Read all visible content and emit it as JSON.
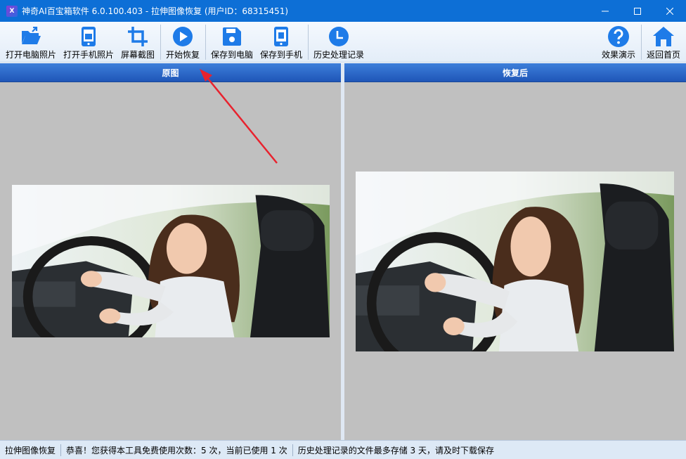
{
  "window": {
    "title": "神奇AI百宝箱软件 6.0.100.403 - 拉伸图像恢复 (用户ID：68315451)",
    "app_icon": "X"
  },
  "toolbar": {
    "open_pc_photo": "打开电脑照片",
    "open_phone_photo": "打开手机照片",
    "screenshot": "屏幕截图",
    "start_restore": "开始恢复",
    "save_to_pc": "保存到电脑",
    "save_to_phone": "保存到手机",
    "history": "历史处理记录",
    "demo": "效果演示",
    "home": "返回首页"
  },
  "panels": {
    "original": "原图",
    "restored": "恢复后"
  },
  "statusbar": {
    "mode": "拉伸图像恢复",
    "usage": "恭喜！您获得本工具免费使用次数：5 次，当前已使用 1 次",
    "storage": "历史处理记录的文件最多存储 3 天，请及时下载保存"
  },
  "colors": {
    "titlebar": "#0d6fd6",
    "accent": "#1e7be8",
    "panel_header": "#2a63c4",
    "canvas": "#c0c0c0",
    "arrow": "#e8222e"
  }
}
